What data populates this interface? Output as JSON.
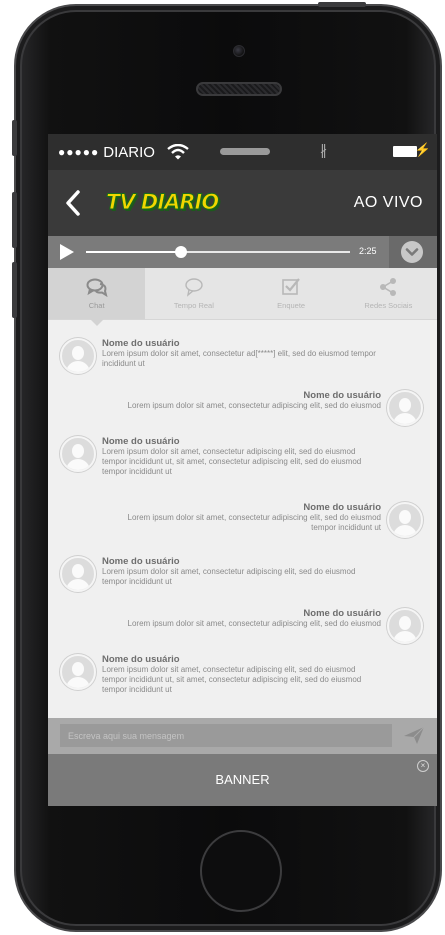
{
  "status_bar": {
    "signal_dots": "●●●●●",
    "carrier": "DIARIO"
  },
  "header": {
    "logo_text": "TV DIARIO",
    "live_label": "AO VIVO"
  },
  "player": {
    "time": "2:25",
    "progress_fraction": 0.36
  },
  "tabs": [
    {
      "label": "Chat",
      "icon": "chat-bubbles-icon"
    },
    {
      "label": "Tempo Real",
      "icon": "speech-bubble-icon"
    },
    {
      "label": "Enquete",
      "icon": "checkbox-icon"
    },
    {
      "label": "Redes Sociais",
      "icon": "share-icon"
    }
  ],
  "messages": [
    {
      "side": "left",
      "user": "Nome do usuário",
      "lines": [
        "Lorem ipsum dolor sit amet, consectetur ad[*****] elit, sed do eiusmod tempor",
        "incididunt ut"
      ]
    },
    {
      "side": "right",
      "user": "Nome do usuário",
      "lines": [
        "Lorem ipsum dolor sit amet, consectetur adipiscing elit, sed do eiusmod"
      ]
    },
    {
      "side": "left",
      "user": "Nome do usuário",
      "lines": [
        "Lorem ipsum dolor sit amet, consectetur adipiscing elit, sed do eiusmod",
        "tempor incididunt ut, sit amet, consectetur adipiscing elit, sed do eiusmod",
        "tempor incididunt ut"
      ]
    },
    {
      "side": "right",
      "user": "Nome do usuário",
      "lines": [
        "Lorem ipsum dolor sit amet, consectetur adipiscing elit, sed do eiusmod",
        "tempor incididunt ut"
      ]
    },
    {
      "side": "left",
      "user": "Nome do usuário",
      "lines": [
        "Lorem ipsum dolor sit amet, consectetur adipiscing elit, sed do eiusmod",
        "tempor incididunt ut"
      ]
    },
    {
      "side": "right",
      "user": "Nome do usuário",
      "lines": [
        "Lorem ipsum dolor sit amet, consectetur adipiscing elit, sed do eiusmod"
      ]
    },
    {
      "side": "left",
      "user": "Nome do usuário",
      "lines": [
        "Lorem ipsum dolor sit amet, consectetur adipiscing elit, sed do eiusmod",
        "tempor incididunt ut, sit amet, consectetur adipiscing elit, sed do eiusmod",
        "tempor incididunt ut"
      ]
    }
  ],
  "composer": {
    "placeholder": "Escreva aqui sua mensagem"
  },
  "banner": {
    "label": "BANNER",
    "close_symbol": "×"
  },
  "colors": {
    "logo_yellow": "#f2d600",
    "logo_green": "#1a6b1a",
    "navbar": "#3a3a3a",
    "banner": "#7a7a7a"
  }
}
